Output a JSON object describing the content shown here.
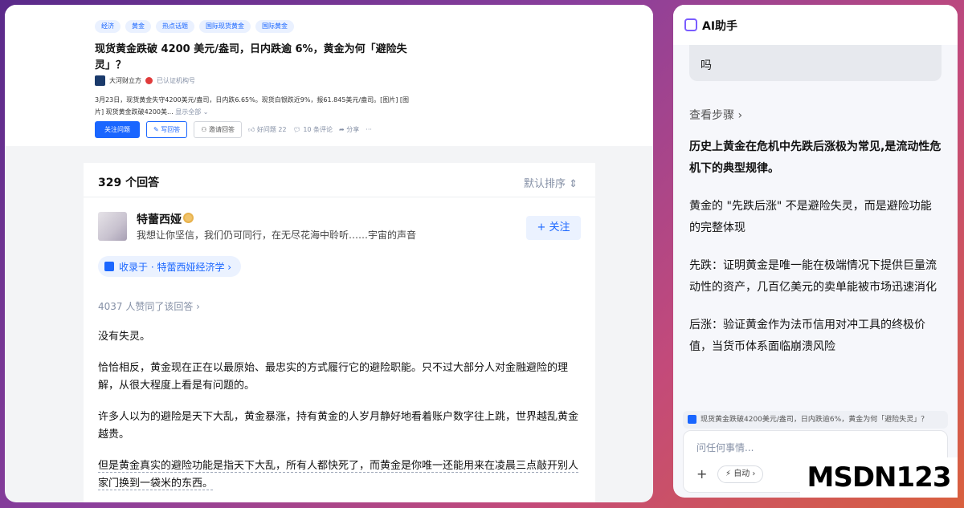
{
  "question": {
    "tags": [
      "经济",
      "黄金",
      "热点话题",
      "国际现货黄金",
      "国际黄金"
    ],
    "title": "现货黄金跌破 4200 美元/盎司，日内跌逾 6%，黄金为何「避险失灵」？",
    "author": "大河财立方",
    "author_sub": "已认证机构号",
    "excerpt": "3月23日，现货黄金失守4200美元/盎司，日内跌6.65%。现货白银跌近9%，报61.845美元/盎司。[图片] [图片] 现货黄金跌破4200美...",
    "excerpt_more": "显示全部 ⌄",
    "btn_follow": "关注问题",
    "btn_write": "✎ 写回答",
    "btn_invite": "邀请回答",
    "good_question": "好问题 22",
    "comments": "10 条评论",
    "share": "分享",
    "more": "···"
  },
  "answer": {
    "count": "329 个回答",
    "sort": "默认排序 ⇕",
    "author_name": "特蕾西娅",
    "author_bio": "我想让你坚信，我们仍可同行，在无尽花海中聆听……宇宙的声音",
    "follow": "+ 关注",
    "collected": "收录于 · 特蕾西娅经济学 ›",
    "upvotes": "4037 人赞同了该回答 ›",
    "paragraphs": [
      "没有失灵。",
      "恰恰相反，黄金现在正在以最原始、最忠实的方式履行它的避险职能。只不过大部分人对金融避险的理解，从很大程度上看是有问题的。",
      "许多人以为的避险是天下大乱，黄金暴涨，持有黄金的人岁月静好地看着账户数字往上跳，世界越乱黄金越贵。",
      "但是黄金真实的避险功能是指天下大乱，所有人都快死了，而黄金是你唯一还能用来在凌晨三点敲开别人家门换到一袋米的东西。"
    ]
  },
  "ai": {
    "title": "AI助手",
    "prev_bubble": "吗",
    "steps": "查看步骤  ›",
    "heading": "历史上黄金在危机中先跌后涨极为常见,是流动性危机下的典型规律。",
    "p1": "黄金的 \"先跌后涨\" 不是避险失灵，而是避险功能的完整体现",
    "p2": "先跌：证明黄金是唯一能在极端情况下提供巨量流动性的资产，几百亿美元的卖单能被市场迅速消化",
    "p3": "后涨：验证黄金作为法币信用对冲工具的终极价值，当货币体系面临崩溃风险",
    "context": "现货黄金跌破4200美元/盎司，日内跌逾6%，黄金为何「避险失灵」？",
    "input_placeholder": "问任何事情...",
    "plus": "+",
    "auto": "⚡ 自动 ›"
  },
  "watermark": "MSDN123"
}
